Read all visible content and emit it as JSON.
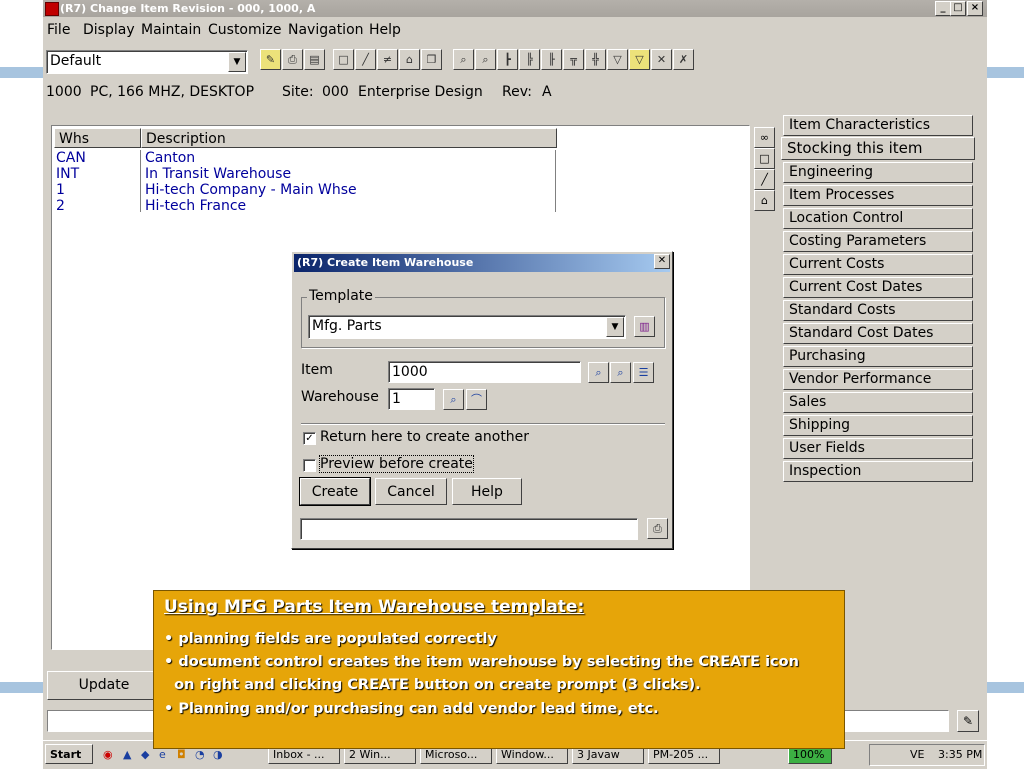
{
  "window": {
    "title": "(R7) Change Item Revision - 000, 1000, A",
    "controls": [
      "_",
      "□",
      "×"
    ]
  },
  "menubar": [
    "File",
    "Display",
    "Maintain",
    "Customize",
    "Navigation",
    "Help"
  ],
  "toolbar": {
    "view_combo": "Default",
    "icons": [
      "note-icon",
      "print-icon",
      "print-preview-icon",
      "new-icon",
      "edit-icon",
      "edit-all-icon",
      "trash-icon",
      "copy-icon",
      "find-icon",
      "find-next-icon",
      "tree-icon",
      "tree-expand-icon",
      "tree-collapse-icon",
      "structure-icon",
      "structure-alt-icon",
      "filter-icon",
      "filter-yellow-icon",
      "filter-clear-icon",
      "filter-edit-icon"
    ]
  },
  "item_info": {
    "item": "1000",
    "description": "PC, 166 MHZ, DESKTOP",
    "site_label": "Site:",
    "site": "000",
    "site_name": "Enterprise Design",
    "rev_label": "Rev:",
    "rev": "A"
  },
  "warehouse_list": {
    "columns": [
      "Whs",
      "Description"
    ],
    "rows": [
      {
        "whs": "CAN",
        "description": "Canton"
      },
      {
        "whs": "INT",
        "description": "In Transit Warehouse"
      },
      {
        "whs": "1",
        "description": "Hi-tech Company - Main Whse"
      },
      {
        "whs": "2",
        "description": "Hi-tech France"
      }
    ]
  },
  "side_icons": [
    "binoculars-icon",
    "new-doc-icon",
    "pencil-icon",
    "trash-icon"
  ],
  "sidebar": {
    "items": [
      "Item Characteristics",
      "Stocking this item",
      "Engineering",
      "Item Processes",
      "Location Control",
      "Costing Parameters",
      "Current Costs",
      "Current Cost Dates",
      "Standard Costs",
      "Standard Cost Dates",
      "Purchasing",
      "Vendor Performance",
      "Sales",
      "Shipping",
      "User Fields",
      "Inspection"
    ],
    "active_index": 1
  },
  "update_button": "Update",
  "dialog": {
    "title": "(R7) Create Item Warehouse",
    "template_legend": "Template",
    "template_value": "Mfg. Parts",
    "item_label": "Item",
    "item_value": "1000",
    "warehouse_label": "Warehouse",
    "warehouse_value": "1",
    "return_label": "Return here to create another",
    "return_checked": true,
    "preview_label": "Preview before create",
    "preview_checked": false,
    "buttons": {
      "create": "Create",
      "cancel": "Cancel",
      "help": "Help"
    }
  },
  "callout": {
    "title": "Using MFG Parts Item Warehouse template:",
    "lines": [
      "• planning fields are populated correctly",
      "• document control creates the item warehouse by selecting the CREATE icon",
      "  on right and clicking CREATE button on create prompt (3 clicks).",
      "• Planning and/or purchasing can add vendor lead time, etc."
    ]
  },
  "taskbar": {
    "start": "Start",
    "tasks": [
      "Inbox - ...",
      "2 Win...",
      "Microso...",
      "Window...",
      "3 Javaw",
      "PM-205 ..."
    ],
    "zoom": "100%",
    "clock": "3:35 PM",
    "tray_text": "VE"
  },
  "colors": {
    "callout_bg": "#e6a509",
    "link_text": "#00009c",
    "dialog_title": "#0a246a",
    "window_bg": "#d4d0c8"
  }
}
